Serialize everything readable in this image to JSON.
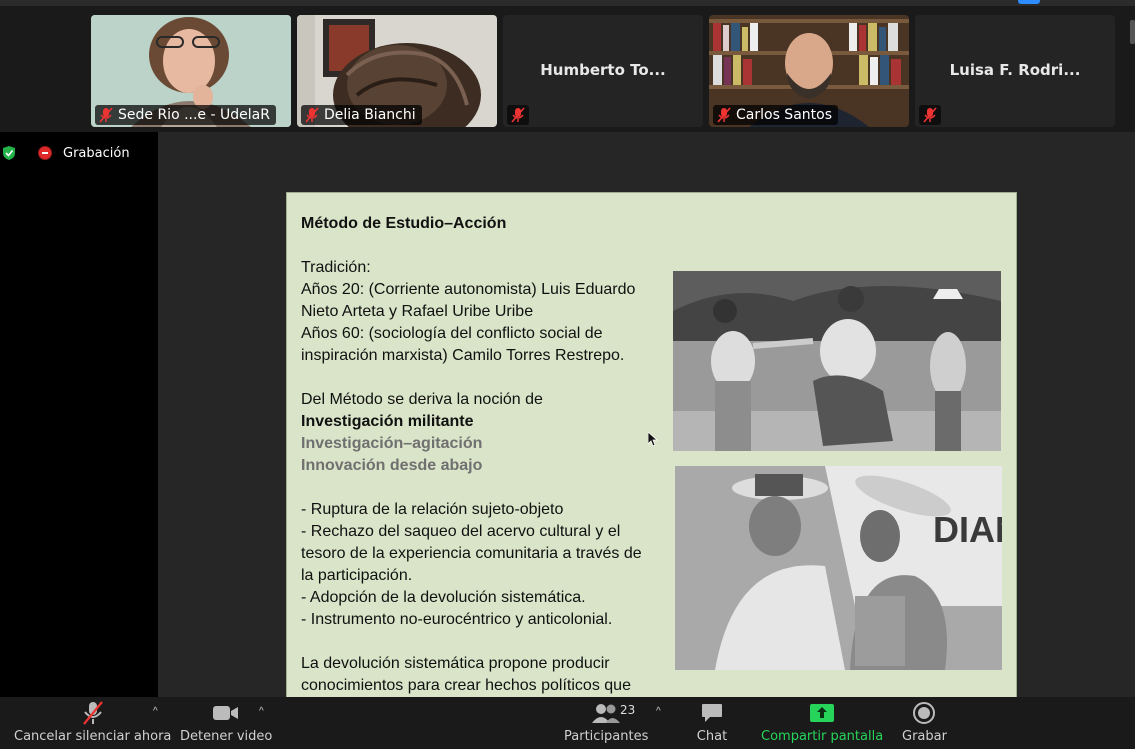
{
  "participants_strip": [
    {
      "name": "Sede Rio ...e - UdelaR",
      "video": true,
      "muted": true
    },
    {
      "name": "Delia Bianchi",
      "video": true,
      "muted": true
    },
    {
      "name": "Humberto To...",
      "video": false,
      "muted": true
    },
    {
      "name": "Carlos Santos",
      "video": true,
      "muted": true
    },
    {
      "name": "Luisa F. Rodri...",
      "video": false,
      "muted": true
    }
  ],
  "recording": {
    "label": "Grabación"
  },
  "slide": {
    "title": "Método de Estudio–Acción",
    "lines": {
      "tradicion": "Tradición:",
      "anos20_a": "Años 20: (Corriente autonomista) Luis Eduardo",
      "anos20_b": "Nieto Arteta y Rafael Uribe Uribe",
      "anos60_a": "Años 60: (sociología del conflicto social de",
      "anos60_b": "inspiración marxista) Camilo Torres Restrepo.",
      "deriva": "Del Método se deriva la noción de",
      "inv_militante": "Investigación militante",
      "inv_agitacion": "Investigación–agitación",
      "innovacion": "Innovación desde abajo",
      "b1": "- Ruptura de la relación sujeto-objeto",
      "b2a": "- Rechazo del saqueo del acervo cultural y el",
      "b2b": "tesoro de la experiencia comunitaria a través de",
      "b2c": "la participación.",
      "b3": "- Adopción de la devolución sistemática.",
      "b4": "- Instrumento no-eurocéntrico y anticolonial.",
      "c1": "La devolución sistemática propone producir",
      "c2": "conocimientos para crear hechos políticos que"
    },
    "photo2_sign": "DIANO"
  },
  "toolbar": {
    "mute_label": "Cancelar silenciar ahora",
    "video_label": "Detener video",
    "participants_label": "Participantes",
    "participants_count": "23",
    "chat_label": "Chat",
    "share_label": "Compartir pantalla",
    "record_label": "Grabar"
  },
  "colors": {
    "share_accent": "#27d45a",
    "rec_red": "#e02828",
    "slide_bg": "#d9e4c8"
  }
}
